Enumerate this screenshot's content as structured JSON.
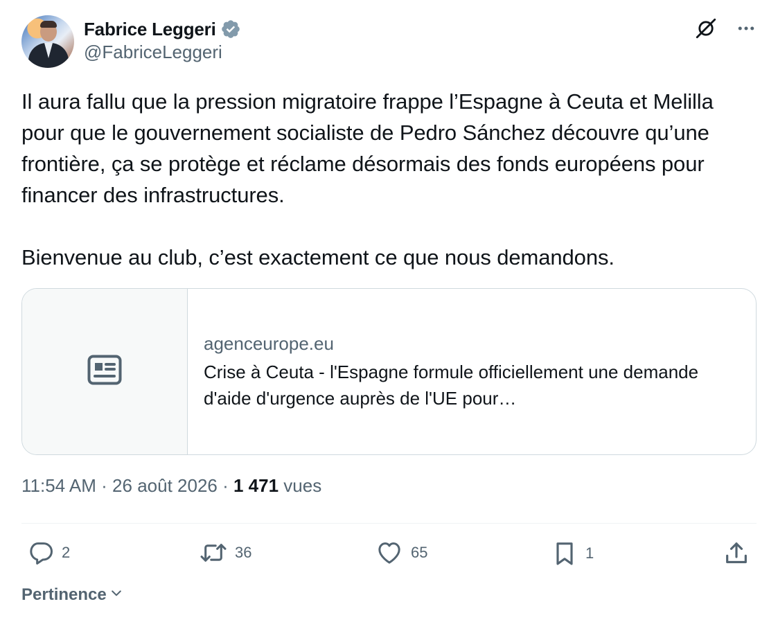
{
  "author": {
    "display_name": "Fabrice Leggeri",
    "handle": "@FabriceLeggeri",
    "verified_icon": "verified-badge-icon",
    "badge_color": "#829aab"
  },
  "top_icons": [
    "grok-icon",
    "more-icon"
  ],
  "tweet": {
    "text": "Il aura fallu que la pression migratoire frappe l’Espagne à Ceuta et Melilla pour que le gouvernement socialiste de Pedro Sánchez découvre qu’une frontière, ça se protège et réclame désormais des fonds européens pour financer des infrastructures.\n\nBienvenue au club, c’est exactement ce que nous demandons."
  },
  "link_card": {
    "domain": "agenceurope.eu",
    "title": "Crise à Ceuta - l'Espagne formule officiellement une demande d'aide d'urgence auprès de l'UE pour…",
    "thumbnail_icon": "article-icon"
  },
  "meta": {
    "time": "11:54 AM",
    "sep1": " · ",
    "date": "26 août 2026",
    "sep2": " · ",
    "views_count": "1 471",
    "views_label": " vues"
  },
  "actions": {
    "replies": "2",
    "reposts": "36",
    "likes": "65",
    "bookmarks": "1"
  },
  "sort": {
    "label": "Pertinence"
  },
  "colors": {
    "text": "#0f1419",
    "secondary": "#536471",
    "border": "#cfd9de"
  }
}
